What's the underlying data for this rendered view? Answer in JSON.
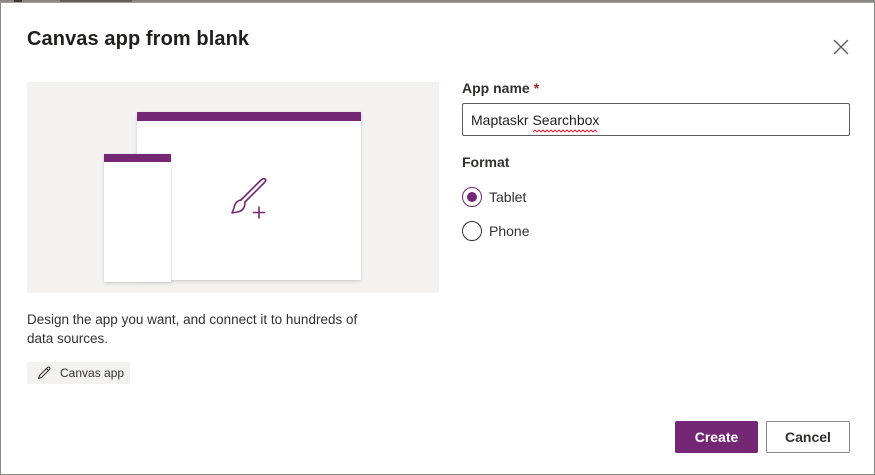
{
  "dialog": {
    "title": "Canvas app from blank",
    "close_icon": "close-icon",
    "illustration_icon": "paintbrush-plus-icon",
    "description": "Design the app you want, and connect it to hundreds of data sources.",
    "chip": {
      "icon": "pen-icon",
      "label": "Canvas app"
    },
    "app_name": {
      "label": "App name",
      "required_mark": "*",
      "value": "Maptaskr Searchbox"
    },
    "format": {
      "label": "Format",
      "options": [
        {
          "label": "Tablet",
          "selected": true
        },
        {
          "label": "Phone",
          "selected": false
        }
      ]
    },
    "buttons": {
      "create": "Create",
      "cancel": "Cancel"
    },
    "colors": {
      "accent": "#742774",
      "illustration_bg": "#f3f2f1",
      "required": "#a4262c"
    }
  }
}
